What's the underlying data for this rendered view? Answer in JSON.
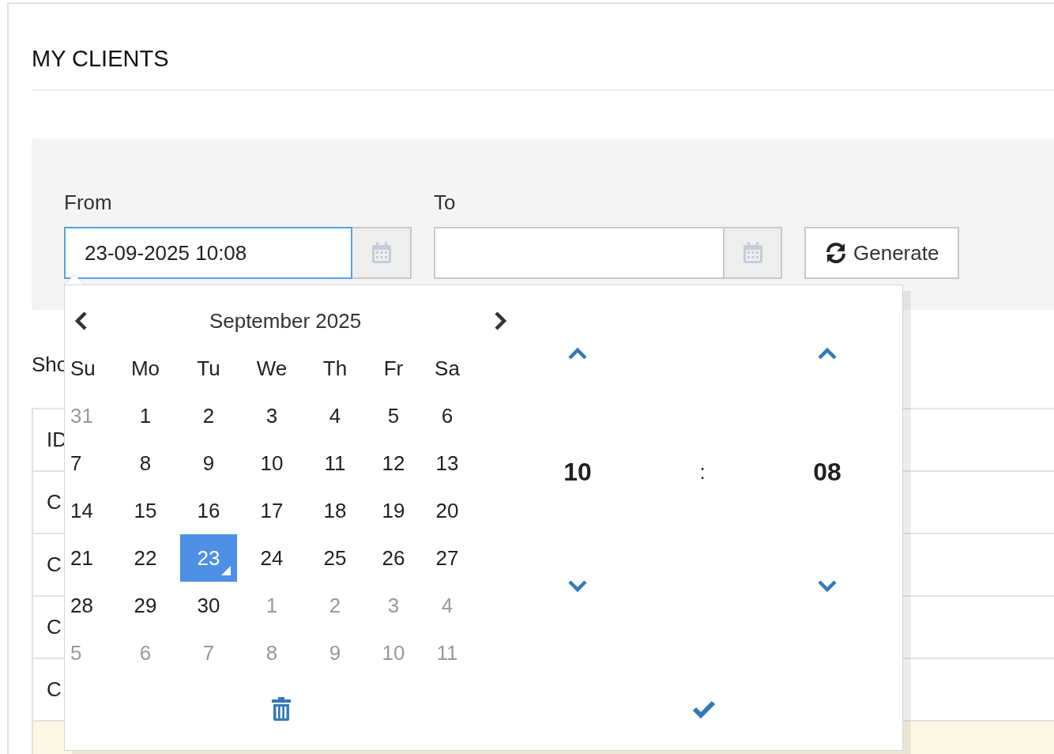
{
  "page": {
    "title": "MY CLIENTS"
  },
  "filters": {
    "fields": [
      {
        "label": "From",
        "value": "23-09-2025 10:08",
        "focused": true
      },
      {
        "label": "To",
        "focused": false
      }
    ],
    "generate_button": {
      "label": "Generate"
    }
  },
  "show_entries": {
    "label": "Sho"
  },
  "table": {
    "columns": [
      "ID"
    ],
    "rows": [
      {
        "cells": [
          "C"
        ],
        "highlighted": false
      },
      {
        "cells": [
          "C"
        ],
        "highlighted": false
      },
      {
        "cells": [
          "C"
        ],
        "highlighted": false
      },
      {
        "cells": [
          "C"
        ],
        "highlighted": false
      },
      {
        "highlighted": true
      }
    ]
  },
  "datepicker": {
    "month_title": "September 2025",
    "weekdays": [
      "Su",
      "Mo",
      "Tu",
      "We",
      "Th",
      "Fr",
      "Sa"
    ],
    "weeks": [
      [
        {
          "label": "31",
          "kind": "old",
          "selected": false
        },
        {
          "label": "1",
          "kind": "current",
          "selected": false
        },
        {
          "label": "2",
          "kind": "current",
          "selected": false
        },
        {
          "label": "3",
          "kind": "current",
          "selected": false
        },
        {
          "label": "4",
          "kind": "current",
          "selected": false
        },
        {
          "label": "5",
          "kind": "current",
          "selected": false
        },
        {
          "label": "6",
          "kind": "current",
          "selected": false
        }
      ],
      [
        {
          "label": "7",
          "kind": "current",
          "selected": false
        },
        {
          "label": "8",
          "kind": "current",
          "selected": false
        },
        {
          "label": "9",
          "kind": "current",
          "selected": false
        },
        {
          "label": "10",
          "kind": "current",
          "selected": false
        },
        {
          "label": "11",
          "kind": "current",
          "selected": false
        },
        {
          "label": "12",
          "kind": "current",
          "selected": false
        },
        {
          "label": "13",
          "kind": "current",
          "selected": false
        }
      ],
      [
        {
          "label": "14",
          "kind": "current",
          "selected": false
        },
        {
          "label": "15",
          "kind": "current",
          "selected": false
        },
        {
          "label": "16",
          "kind": "current",
          "selected": false
        },
        {
          "label": "17",
          "kind": "current",
          "selected": false
        },
        {
          "label": "18",
          "kind": "current",
          "selected": false
        },
        {
          "label": "19",
          "kind": "current",
          "selected": false
        },
        {
          "label": "20",
          "kind": "current",
          "selected": false
        }
      ],
      [
        {
          "label": "21",
          "kind": "current",
          "selected": false
        },
        {
          "label": "22",
          "kind": "current",
          "selected": false
        },
        {
          "label": "23",
          "kind": "current",
          "selected": true
        },
        {
          "label": "24",
          "kind": "current",
          "selected": false
        },
        {
          "label": "25",
          "kind": "current",
          "selected": false
        },
        {
          "label": "26",
          "kind": "current",
          "selected": false
        },
        {
          "label": "27",
          "kind": "current",
          "selected": false
        }
      ],
      [
        {
          "label": "28",
          "kind": "current",
          "selected": false
        },
        {
          "label": "29",
          "kind": "current",
          "selected": false
        },
        {
          "label": "30",
          "kind": "current",
          "selected": false
        },
        {
          "label": "1",
          "kind": "new",
          "selected": false
        },
        {
          "label": "2",
          "kind": "new",
          "selected": false
        },
        {
          "label": "3",
          "kind": "new",
          "selected": false
        },
        {
          "label": "4",
          "kind": "new",
          "selected": false
        }
      ],
      [
        {
          "label": "5",
          "kind": "new",
          "selected": false
        },
        {
          "label": "6",
          "kind": "new",
          "selected": false
        },
        {
          "label": "7",
          "kind": "new",
          "selected": false
        },
        {
          "label": "8",
          "kind": "new",
          "selected": false
        },
        {
          "label": "9",
          "kind": "new",
          "selected": false
        },
        {
          "label": "10",
          "kind": "new",
          "selected": false
        },
        {
          "label": "11",
          "kind": "new",
          "selected": false
        }
      ]
    ],
    "time": {
      "hour": "10",
      "separator": ":",
      "minute": "08"
    }
  }
}
